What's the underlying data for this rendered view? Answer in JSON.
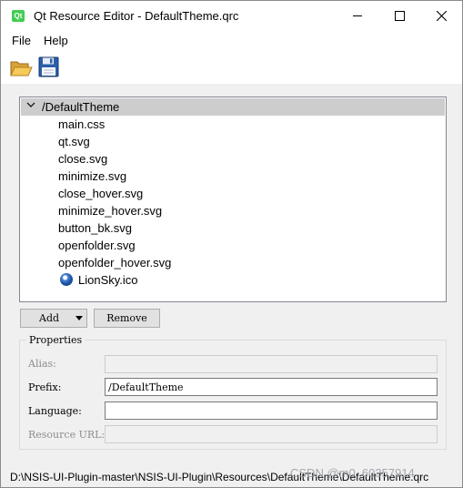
{
  "window": {
    "app_icon_text": "Qt",
    "title": "Qt Resource Editor - DefaultTheme.qrc"
  },
  "menu": {
    "file": "File",
    "help": "Help"
  },
  "toolbar": {
    "open_icon": "open-folder-icon",
    "save_icon": "floppy-disk-icon"
  },
  "tree": {
    "root": "/DefaultTheme",
    "files": [
      "main.css",
      "qt.svg",
      "close.svg",
      "minimize.svg",
      "close_hover.svg",
      "minimize_hover.svg",
      "button_bk.svg",
      "openfolder.svg",
      "openfolder_hover.svg",
      "LionSky.ico"
    ]
  },
  "buttons": {
    "add": "Add",
    "remove": "Remove"
  },
  "properties": {
    "title": "Properties",
    "alias_label": "Alias:",
    "alias_value": "",
    "prefix_label": "Prefix:",
    "prefix_value": "/DefaultTheme",
    "language_label": "Language:",
    "language_value": "",
    "url_label": "Resource URL:",
    "url_value": ""
  },
  "status": {
    "path": "D:\\NSIS-UI-Plugin-master\\NSIS-UI-Plugin\\Resources\\DefaultTheme\\DefaultTheme.qrc"
  },
  "watermark": "CSDN @m0_60357914"
}
